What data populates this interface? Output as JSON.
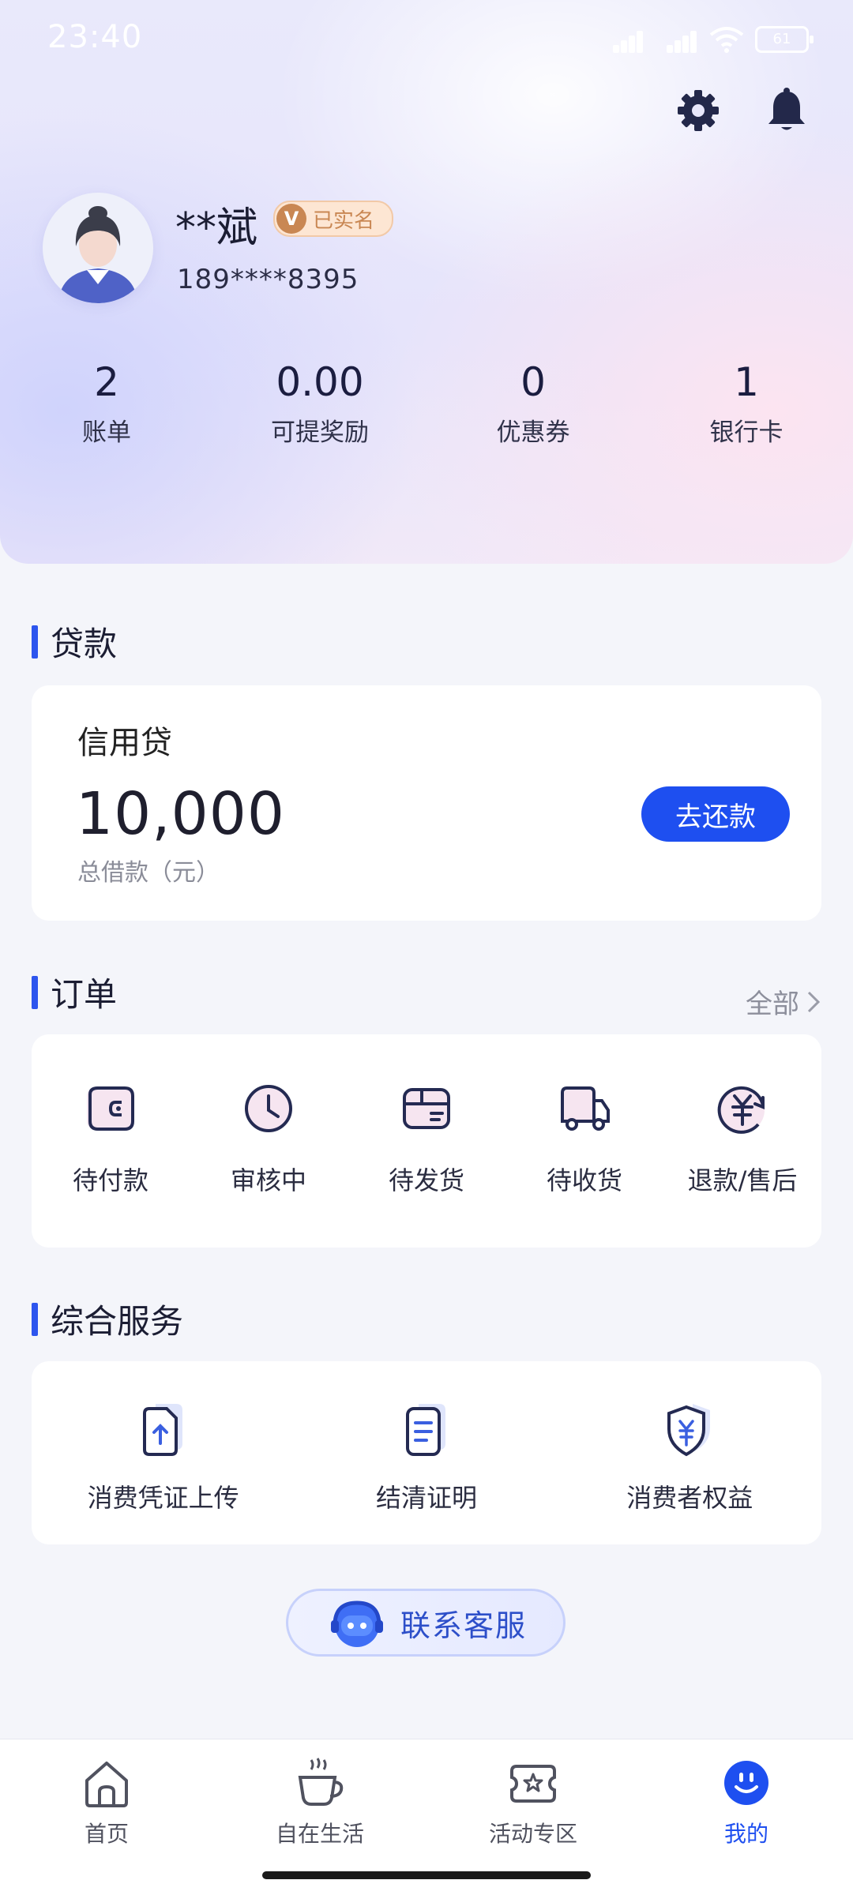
{
  "status_bar": {
    "time": "23:40",
    "battery": "61"
  },
  "profile": {
    "name": "**斌",
    "verified_label": "已实名",
    "verified_badge_letter": "V",
    "phone": "189****8395"
  },
  "stats": [
    {
      "value": "2",
      "label": "账单"
    },
    {
      "value": "0.00",
      "label": "可提奖励"
    },
    {
      "value": "0",
      "label": "优惠券"
    },
    {
      "value": "1",
      "label": "银行卡"
    }
  ],
  "loan_section": {
    "title": "贷款",
    "product_name": "信用贷",
    "amount": "10,000",
    "caption": "总借款（元）",
    "repay_button": "去还款"
  },
  "orders_section": {
    "title": "订单",
    "all_link": "全部",
    "items": [
      {
        "label": "待付款",
        "icon": "wallet-icon"
      },
      {
        "label": "审核中",
        "icon": "clock-icon"
      },
      {
        "label": "待发货",
        "icon": "package-icon"
      },
      {
        "label": "待收货",
        "icon": "truck-icon"
      },
      {
        "label": "退款/售后",
        "icon": "refund-icon"
      }
    ]
  },
  "services_section": {
    "title": "综合服务",
    "items": [
      {
        "label": "消费凭证上传",
        "icon": "upload-document-icon"
      },
      {
        "label": "结清证明",
        "icon": "certificate-icon"
      },
      {
        "label": "消费者权益",
        "icon": "shield-yuan-icon"
      }
    ]
  },
  "customer_service": {
    "label": "联系客服"
  },
  "tabs": [
    {
      "label": "首页",
      "icon": "home-icon",
      "active": false
    },
    {
      "label": "自在生活",
      "icon": "coffee-cup-icon",
      "active": false
    },
    {
      "label": "活动专区",
      "icon": "ticket-star-icon",
      "active": false
    },
    {
      "label": "我的",
      "icon": "smiley-icon",
      "active": true
    }
  ],
  "colors": {
    "accent": "#1e4ff0",
    "section_bar": "#2d55ee",
    "badge_bg": "#fde6d3",
    "badge_text": "#c98753",
    "page_bg": "#f4f5fa"
  }
}
